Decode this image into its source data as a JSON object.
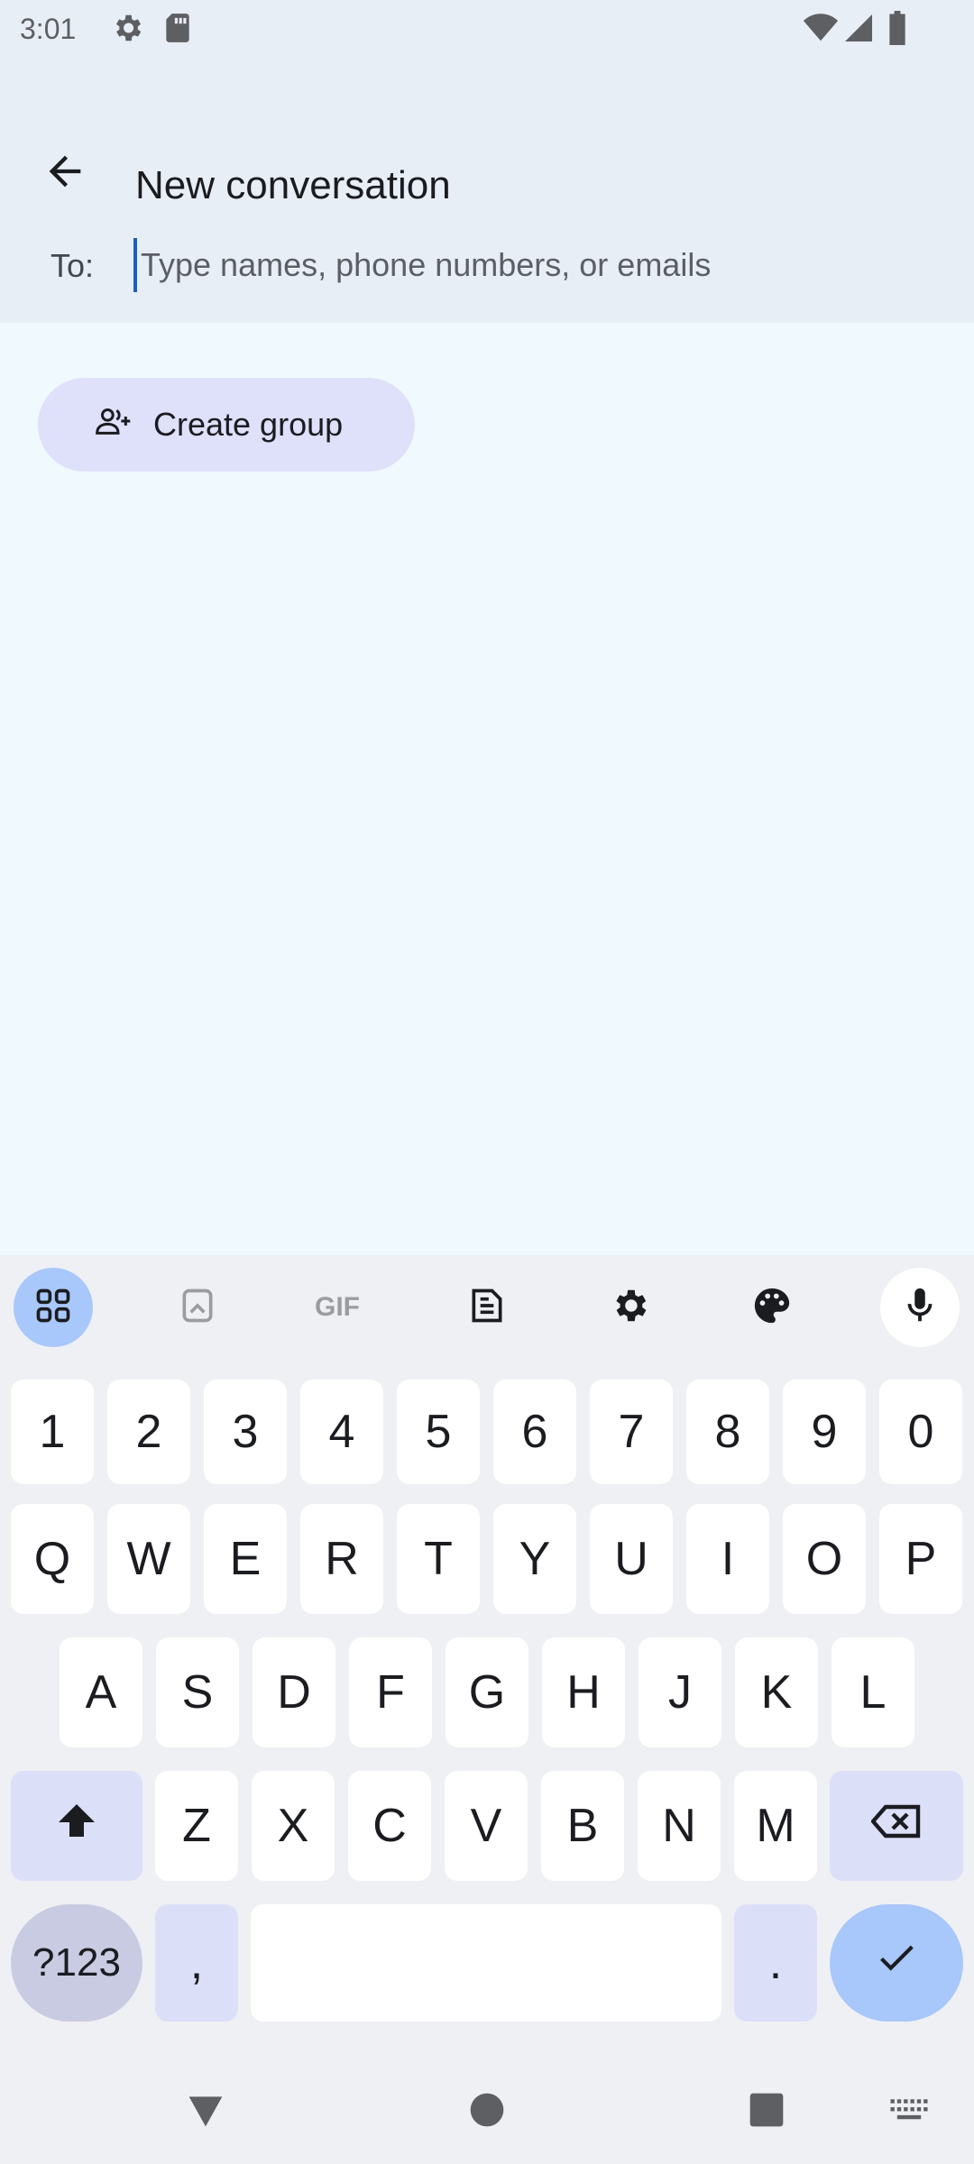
{
  "status_bar": {
    "time": "3:01",
    "icons": [
      "settings-icon",
      "sd-card-icon",
      "wifi-icon",
      "signal-icon",
      "battery-icon"
    ]
  },
  "app_bar": {
    "back_icon": "arrow-back-icon",
    "title": "New conversation"
  },
  "recipient": {
    "label": "To:",
    "placeholder": "Type names, phone numbers, or emails",
    "value": ""
  },
  "actions": {
    "create_group_label": "Create group",
    "create_group_icon": "group-add-icon"
  },
  "keyboard": {
    "toolbar": [
      "apps-grid-icon",
      "clipboard-icon",
      "gif-icon",
      "text-edit-icon",
      "gear-icon",
      "palette-icon",
      "microphone-icon"
    ],
    "gif_label": "GIF",
    "numbers": [
      "1",
      "2",
      "3",
      "4",
      "5",
      "6",
      "7",
      "8",
      "9",
      "0"
    ],
    "row1": [
      "Q",
      "W",
      "E",
      "R",
      "T",
      "Y",
      "U",
      "I",
      "O",
      "P"
    ],
    "row2": [
      "A",
      "S",
      "D",
      "F",
      "G",
      "H",
      "J",
      "K",
      "L"
    ],
    "row3": [
      "Z",
      "X",
      "C",
      "V",
      "B",
      "N",
      "M"
    ],
    "symbols_key": "?123",
    "comma_key": ",",
    "period_key": ".",
    "colors": {
      "accent": "#a8c7fa",
      "fn_key": "#dcdff8",
      "key": "#ffffff",
      "bg": "#eef0f3"
    }
  },
  "colors": {
    "header_bg": "#e8eef5",
    "content_bg": "#f0f9fe",
    "chip_bg": "#dfe0fa",
    "cursor": "#1a5fbf"
  }
}
